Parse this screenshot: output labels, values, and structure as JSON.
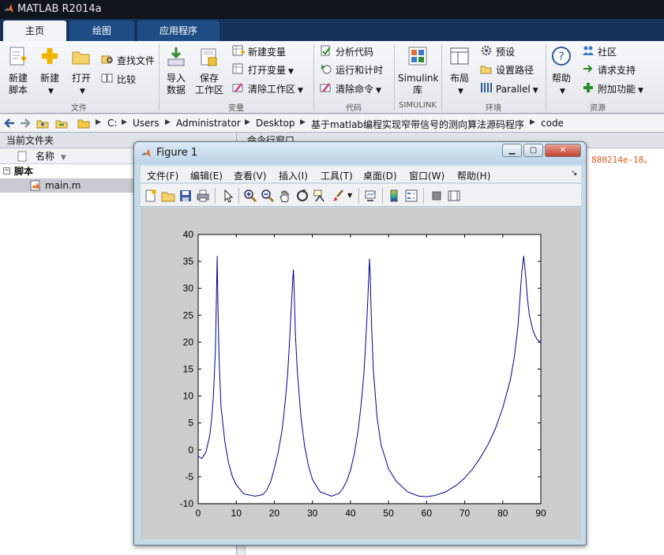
{
  "app": {
    "title": "MATLAB R2014a"
  },
  "tabs": [
    {
      "label": "主页",
      "active": true
    },
    {
      "label": "绘图",
      "active": false
    },
    {
      "label": "应用程序",
      "active": false
    }
  ],
  "ribbon": {
    "file": {
      "new_script_line1": "新建",
      "new_script_line2": "脚本",
      "new": "新建",
      "open": "打开",
      "find_files": "查找文件",
      "compare": "比较",
      "group_label": "文件"
    },
    "variable": {
      "import_line1": "导入",
      "import_line2": "数据",
      "save_line1": "保存",
      "save_line2": "工作区",
      "new_variable": "新建变量",
      "open_variable": "打开变量",
      "clear_workspace": "清除工作区",
      "group_label": "变量"
    },
    "code": {
      "analyze": "分析代码",
      "run_time": "运行和计时",
      "clear_commands": "清除命令",
      "group_label": "代码"
    },
    "simulink": {
      "line1": "Simulink",
      "line2": "库",
      "group_label": "SIMULINK"
    },
    "environment": {
      "layout": "布局",
      "preferences": "预设",
      "set_path": "设置路径",
      "parallel": "Parallel",
      "group_label": "环境"
    },
    "resources": {
      "help": "帮助",
      "community": "社区",
      "request_support": "请求支持",
      "addons": "附加功能",
      "group_label": "资源"
    }
  },
  "address": {
    "crumbs": [
      "C:",
      "Users",
      "Administrator",
      "Desktop",
      "基于matlab编程实现窄带信号的测向算法源码程序",
      "code"
    ]
  },
  "current_folder": {
    "title": "当前文件夹",
    "column_name": "名称",
    "folder": "脚本",
    "file": "main.m"
  },
  "command_window": {
    "title": "命令行窗口",
    "output": "880214e-18。"
  },
  "figure": {
    "title": "Figure 1",
    "menus": [
      "文件(F)",
      "编辑(E)",
      "查看(V)",
      "插入(I)",
      "工具(T)",
      "桌面(D)",
      "窗口(W)",
      "帮助(H)"
    ],
    "icons": {
      "new": "new-figure-icon",
      "open": "open-file-icon",
      "save": "save-icon",
      "print": "print-icon",
      "select": "pointer-icon",
      "zoom_in": "zoom-in-icon",
      "zoom_out": "zoom-out-icon",
      "pan": "pan-hand-icon",
      "rotate": "rotate-3d-icon",
      "datacursor": "data-cursor-icon",
      "brush": "brush-icon",
      "link": "link-plot-icon",
      "colorbar": "colorbar-icon",
      "legend": "legend-icon",
      "hide_tools": "hide-plot-tools-icon",
      "show_tools": "show-plot-tools-icon"
    }
  },
  "chart_data": {
    "type": "line",
    "xlim": [
      0,
      90
    ],
    "ylim": [
      -10,
      40
    ],
    "xticks": [
      0,
      10,
      20,
      30,
      40,
      50,
      60,
      70,
      80,
      90
    ],
    "yticks": [
      -10,
      -5,
      0,
      5,
      10,
      15,
      20,
      25,
      30,
      35,
      40
    ],
    "grid": false,
    "color": "#00008b",
    "series": [
      {
        "x": [
          0,
          1,
          2,
          3,
          3.5,
          4,
          4.5,
          4.8,
          5,
          5.2,
          5.5,
          6,
          7,
          8,
          9,
          10,
          12,
          15,
          17,
          18,
          19,
          20,
          21,
          22,
          22.5,
          23,
          23.5,
          24,
          24.5,
          24.8,
          25,
          25.2,
          25.5,
          26,
          27,
          28,
          29,
          30,
          32,
          35,
          37,
          38,
          39,
          40,
          41,
          42,
          42.5,
          43,
          43.5,
          44,
          44.5,
          44.8,
          45,
          45.2,
          45.5,
          46,
          47,
          48,
          50,
          52,
          55,
          58,
          60,
          62,
          65,
          68,
          70,
          72,
          74,
          76,
          78,
          80,
          82,
          83,
          84,
          84.5,
          85,
          85.5,
          86,
          86.5,
          87,
          88,
          89,
          90
        ],
        "y": [
          -1.2,
          -1.6,
          -0.5,
          2.5,
          5.5,
          10,
          18,
          28,
          36,
          26,
          17,
          8,
          1.5,
          -2.5,
          -5,
          -6.5,
          -8.2,
          -8.6,
          -8.3,
          -7.5,
          -6,
          -3.5,
          -0.5,
          3.5,
          6.5,
          10,
          14,
          20,
          27,
          31,
          33.5,
          30,
          22,
          15,
          6,
          0.5,
          -3,
          -5.5,
          -7.8,
          -8.6,
          -8.1,
          -7.2,
          -5.8,
          -3.8,
          -0.8,
          3.5,
          6.5,
          10,
          14,
          20,
          27,
          32,
          35.5,
          32,
          24,
          15,
          6,
          1,
          -3.5,
          -5.8,
          -7.8,
          -8.6,
          -8.7,
          -8.5,
          -7.8,
          -6.5,
          -5.2,
          -3.6,
          -1.6,
          0.8,
          3.8,
          7.8,
          13,
          17,
          23,
          28,
          33,
          36,
          32.5,
          28,
          25,
          22,
          20.5,
          20
        ]
      }
    ]
  }
}
